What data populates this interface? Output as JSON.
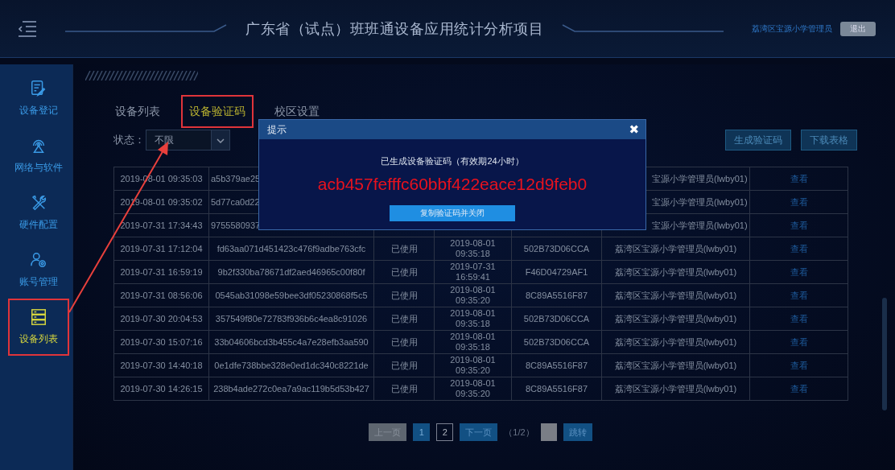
{
  "header": {
    "title": "广东省（试点）班班通设备应用统计分析项目",
    "user": "荔湾区宝源小学管理员",
    "logout": "退出"
  },
  "sidebar": {
    "items": [
      {
        "label": "设备登记",
        "selected": false,
        "highlighted": false
      },
      {
        "label": "网络与软件",
        "selected": false,
        "highlighted": false
      },
      {
        "label": "硬件配置",
        "selected": false,
        "highlighted": false
      },
      {
        "label": "账号管理",
        "selected": false,
        "highlighted": false
      },
      {
        "label": "设备列表",
        "selected": true,
        "highlighted": true
      }
    ]
  },
  "tabs": [
    {
      "label": "设备列表",
      "selected": false,
      "highlighted": false
    },
    {
      "label": "设备验证码",
      "selected": true,
      "highlighted": true
    },
    {
      "label": "校区设置",
      "selected": false,
      "highlighted": false
    }
  ],
  "filter": {
    "label": "状态：",
    "value": "不限"
  },
  "actions": [
    "生成验证码",
    "下载表格"
  ],
  "table": {
    "rows": [
      {
        "time": "2019-08-01 09:35:03",
        "code": "a5b379ae25",
        "admin": "宝源小学管理员(lwby01)",
        "action": "查看",
        "covered": true
      },
      {
        "time": "2019-08-01 09:35:02",
        "code": "5d77ca0d22",
        "admin": "宝源小学管理员(lwby01)",
        "action": "查看",
        "covered": true
      },
      {
        "time": "2019-07-31 17:34:43",
        "code": "9755580937",
        "admin": "宝源小学管理员(lwby01)",
        "action": "查看",
        "covered": true
      },
      {
        "time": "2019-07-31 17:12:04",
        "code": "fd63aa071d451423c476f9adbe763cfc",
        "status": "已使用",
        "used_at": "2019-08-01 09:35:18",
        "device": "502B73D06CCA",
        "admin": "荔湾区宝源小学管理员(lwby01)",
        "action": "查看",
        "covered": false
      },
      {
        "time": "2019-07-31 16:59:19",
        "code": "9b2f330ba78671df2aed46965c00f80f",
        "status": "已使用",
        "used_at": "2019-07-31 16:59:41",
        "device": "F46D04729AF1",
        "admin": "荔湾区宝源小学管理员(lwby01)",
        "action": "查看",
        "covered": false
      },
      {
        "time": "2019-07-31 08:56:06",
        "code": "0545ab31098e59bee3df05230868f5c5",
        "status": "已使用",
        "used_at": "2019-08-01 09:35:20",
        "device": "8C89A5516F87",
        "admin": "荔湾区宝源小学管理员(lwby01)",
        "action": "查看",
        "covered": false
      },
      {
        "time": "2019-07-30 20:04:53",
        "code": "357549f80e72783f936b6c4ea8c91026",
        "status": "已使用",
        "used_at": "2019-08-01 09:35:18",
        "device": "502B73D06CCA",
        "admin": "荔湾区宝源小学管理员(lwby01)",
        "action": "查看",
        "covered": false
      },
      {
        "time": "2019-07-30 15:07:16",
        "code": "33b04606bcd3b455c4a7e28efb3aa590",
        "status": "已使用",
        "used_at": "2019-08-01 09:35:18",
        "device": "502B73D06CCA",
        "admin": "荔湾区宝源小学管理员(lwby01)",
        "action": "查看",
        "covered": false
      },
      {
        "time": "2019-07-30 14:40:18",
        "code": "0e1dfe738bbe328e0ed1dc340c8221de",
        "status": "已使用",
        "used_at": "2019-08-01 09:35:20",
        "device": "8C89A5516F87",
        "admin": "荔湾区宝源小学管理员(lwby01)",
        "action": "查看",
        "covered": false
      },
      {
        "time": "2019-07-30 14:26:15",
        "code": "238b4ade272c0ea7a9ac119b5d53b427",
        "status": "已使用",
        "used_at": "2019-08-01 09:35:20",
        "device": "8C89A5516F87",
        "admin": "荔湾区宝源小学管理员(lwby01)",
        "action": "查看",
        "covered": false
      }
    ]
  },
  "pagination": {
    "prev": {
      "label": "上一页",
      "disabled": true
    },
    "pages": [
      {
        "label": "1",
        "selected": true
      },
      {
        "label": "2",
        "selected": false
      }
    ],
    "next": {
      "label": "下一页",
      "disabled": false
    },
    "info": "（1/2）",
    "go": "跳转"
  },
  "dialog": {
    "title": "提示",
    "close": "✖",
    "message": "已生成设备验证码（有效期24小时）",
    "code": "acb457fefffc60bbf422eace12d9feb0",
    "button": "复制验证码并关闭"
  }
}
